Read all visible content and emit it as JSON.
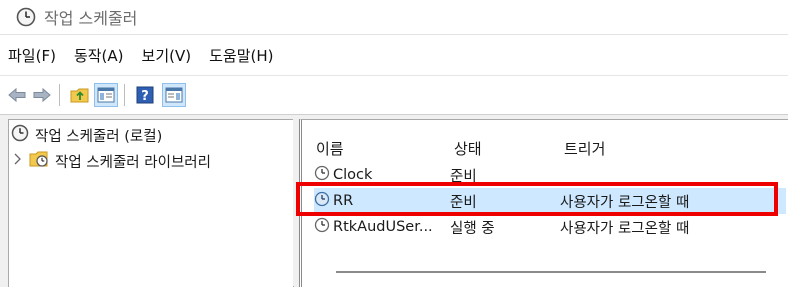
{
  "window": {
    "title": "작업 스케줄러"
  },
  "menu": {
    "items": [
      "파일(F)",
      "동작(A)",
      "보기(V)",
      "도움말(H)"
    ]
  },
  "tree": {
    "root_label": "작업 스케줄러 (로컬)",
    "child_label": "작업 스케줄러 라이브러리"
  },
  "columns": {
    "name": "이름",
    "state": "상태",
    "trigger": "트리거"
  },
  "tasks": [
    {
      "name": "Clock",
      "state": "준비",
      "trigger": ""
    },
    {
      "name": "RR",
      "state": "준비",
      "trigger": "사용자가 로그온할 때"
    },
    {
      "name": "RtkAudUSer...",
      "state": "실행 중",
      "trigger": "사용자가 로그온할 때"
    }
  ],
  "colors": {
    "highlight": "#ee0000",
    "selection": "#cde8ff"
  }
}
